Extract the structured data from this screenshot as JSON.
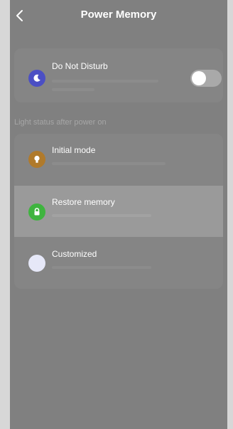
{
  "header": {
    "title": "Power Memory",
    "back_icon": "chevron-left-icon"
  },
  "dnd": {
    "label": "Do Not Disturb",
    "icon": "moon-icon",
    "icon_color": "#4b4fc4",
    "enabled": false
  },
  "section": {
    "label": "Light status after power on"
  },
  "modes": [
    {
      "label": "Initial mode",
      "icon": "bulb-icon",
      "icon_color": "#b07a2b",
      "selected": false
    },
    {
      "label": "Restore memory",
      "icon": "lock-icon",
      "icon_color": "#3fb43f",
      "selected": true
    },
    {
      "label": "Customized",
      "icon": "circle-icon",
      "icon_color": "#e6e8f8",
      "selected": false
    }
  ]
}
